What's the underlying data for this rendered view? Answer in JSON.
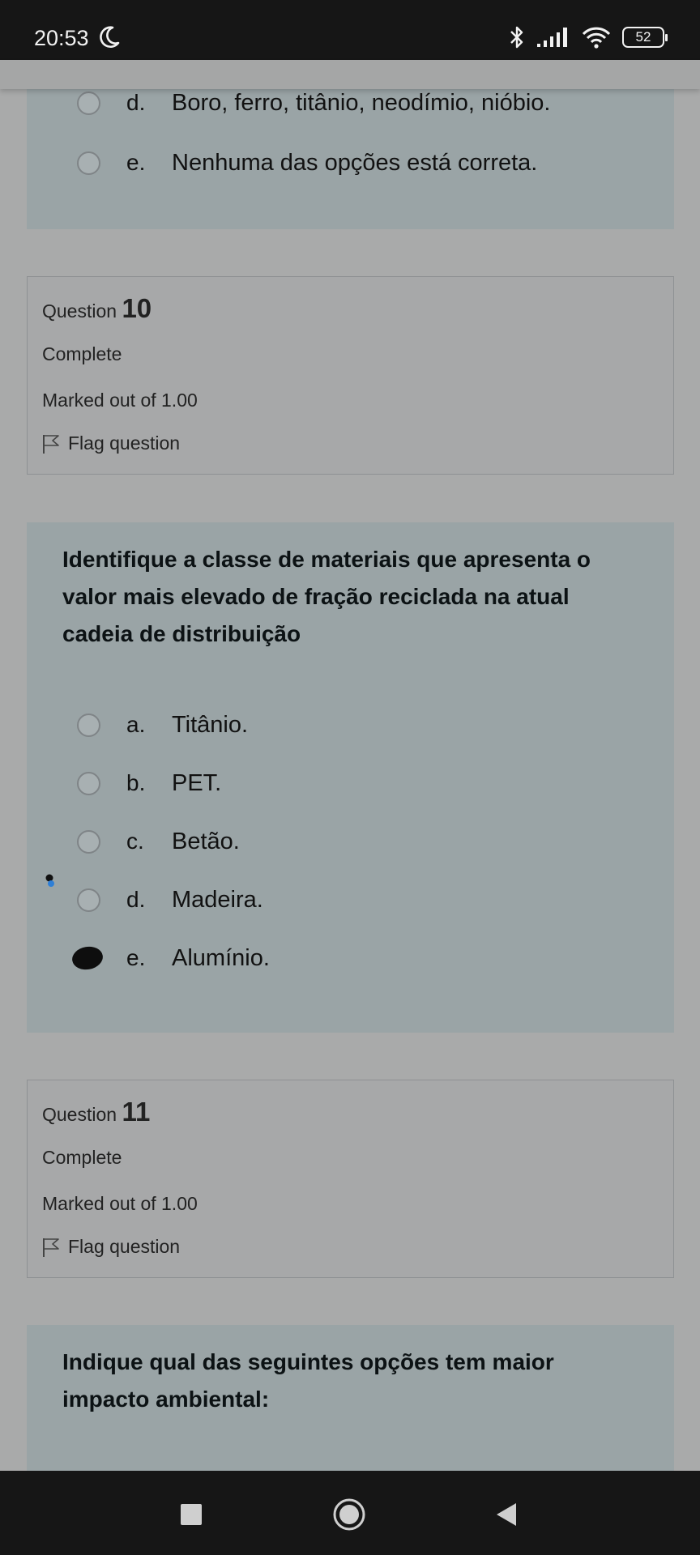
{
  "status_bar": {
    "time": "20:53",
    "battery": "52",
    "icons": [
      "moon-icon",
      "bluetooth-icon",
      "signal-icon",
      "wifi-icon",
      "battery-icon"
    ]
  },
  "prev_question": {
    "options": [
      {
        "letter": "d.",
        "text": "Boro, ferro, titânio, neodímio, nióbio.",
        "selected": false
      },
      {
        "letter": "e.",
        "text": "Nenhuma das opções está correta.",
        "selected": false
      }
    ]
  },
  "question10": {
    "label": "Question",
    "number": "10",
    "state": "Complete",
    "grade": "Marked out of 1.00",
    "flag": "Flag question",
    "prompt": "Identifique a classe de materiais que apresenta o valor mais elevado de fração reciclada na atual cadeia de distribuição",
    "options": [
      {
        "letter": "a.",
        "text": "Titânio.",
        "selected": false
      },
      {
        "letter": "b.",
        "text": "PET.",
        "selected": false
      },
      {
        "letter": "c.",
        "text": "Betão.",
        "selected": false
      },
      {
        "letter": "d.",
        "text": "Madeira.",
        "selected": false
      },
      {
        "letter": "e.",
        "text": "Alumínio.",
        "selected": true
      }
    ]
  },
  "question11": {
    "label": "Question",
    "number": "11",
    "state": "Complete",
    "grade": "Marked out of 1.00",
    "flag": "Flag question",
    "prompt": "Indique qual das seguintes opções tem maior impacto ambiental:"
  },
  "colors": {
    "background": "#a9aaaa",
    "panel": "#9aa4a6",
    "info_box": "#a7a8a9",
    "system_bars": "#161616"
  }
}
